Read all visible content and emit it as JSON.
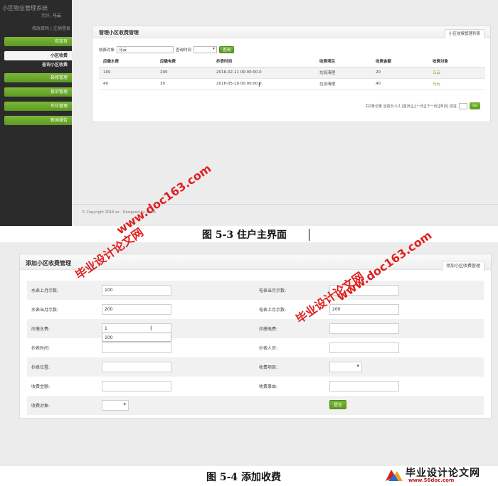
{
  "fig1": {
    "sidebar": {
      "system_title": "小区物业管理系统",
      "welcome_prefix": "您好,",
      "user": "马云",
      "account_links": "修改密码 | 注销登录",
      "nav": [
        {
          "label": "欢迎页",
          "active": false
        },
        {
          "label": "小区收费",
          "active": true
        },
        {
          "label": "装修管理",
          "active": false
        },
        {
          "label": "投诉管理",
          "active": false
        },
        {
          "label": "车位管理",
          "active": false
        },
        {
          "label": "新闻通告",
          "active": false
        }
      ],
      "sub_item": "查询小区收费"
    },
    "panel": {
      "title": "管理小区收费管理",
      "tab": "小区收费管理列表",
      "search": {
        "label": "收费对象",
        "value": "马云",
        "time_label": "查询时间",
        "button": "查询"
      },
      "table": {
        "headers": [
          "应缴水费",
          "应缴电费",
          "抄表时间",
          "收费项目",
          "收费金额",
          "收费对象"
        ],
        "rows": [
          [
            "100",
            "200",
            "2016-02-11 00:00:00.0",
            "垃圾清理",
            "20",
            "马云"
          ],
          [
            "40",
            "30",
            "2016-05-19 00:00:00.0",
            "垃圾清理",
            "40",
            "马云"
          ]
        ]
      },
      "pager": {
        "text": "共2条记录 当前页:1/1 [首页][上一页][下一页][末页] 前往",
        "go": "Go"
      }
    },
    "copyright": "© Copyright 2016 xx · Designed by xx-xx",
    "caption": "图 5-3  住户主界面"
  },
  "fig2": {
    "panel": {
      "title": "添加小区收费管理",
      "tab": "添加小区收费管理"
    },
    "rows": [
      {
        "l1": "水表上月示数:",
        "v1": "100",
        "l2": "电表当月示数:",
        "v2": ""
      },
      {
        "l1": "水表当月示数:",
        "v1": "200",
        "l2": "电表上月示数:",
        "v2": "200"
      },
      {
        "l1": "应缴水费:",
        "v1": "1",
        "l2": "应缴电费:",
        "v2": ""
      },
      {
        "l1": "抄表时间:",
        "v1": "",
        "l2": "抄表人员:",
        "v2": ""
      },
      {
        "l1": "抄表位置:",
        "v1": "",
        "l2": "收费项目:",
        "v2": ""
      },
      {
        "l1": "收费金额:",
        "v1": "",
        "l2": "收费事由:",
        "v2": ""
      },
      {
        "l1": "收费对象:",
        "v1": "",
        "l2": "",
        "v2": ""
      }
    ],
    "autocomplete": "100",
    "submit": "提交",
    "caption": "图 5-4  添加收费"
  },
  "watermarks": {
    "site_a": "www.doc163.com",
    "site_b": "毕业设计论文网",
    "site_c": "毕业设计论文网",
    "site_d": "www.doc163.com"
  },
  "logo": {
    "text": "毕业设计论文网",
    "url": "www.56doc.com"
  }
}
